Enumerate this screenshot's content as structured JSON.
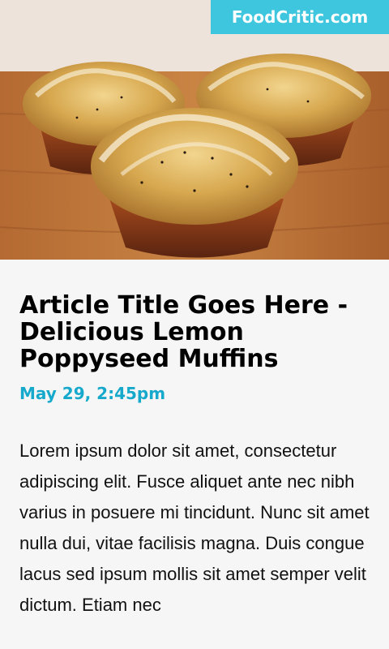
{
  "header": {
    "brand": "FoodCritic.com",
    "hero_image_alt": "lemon poppyseed muffins"
  },
  "article": {
    "title": "Article Title Goes Here - Delicious Lemon Poppyseed Muffins",
    "date": "May 29, 2:45pm",
    "body": "Lorem ipsum dolor sit amet, consectetur adipiscing elit. Fusce aliquet ante nec nibh varius in posuere mi tincidunt. Nunc sit amet nulla dui, vitae facilisis magna. Duis congue lacus sed ipsum mollis sit amet semper velit dictum. Etiam nec"
  },
  "colors": {
    "brand_bg": "#3ec6df",
    "date_accent": "#16a9cc",
    "page_bg": "#f6f6f6"
  }
}
